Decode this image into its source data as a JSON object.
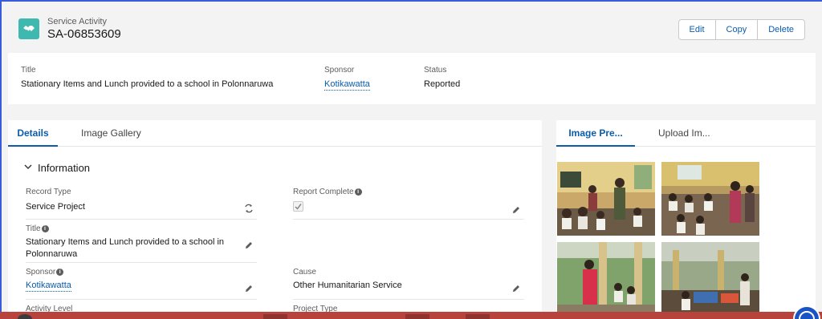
{
  "header": {
    "object_type": "Service Activity",
    "record_name": "SA-06853609",
    "buttons": {
      "edit": "Edit",
      "copy": "Copy",
      "delete": "Delete"
    }
  },
  "highlights": {
    "title_label": "Title",
    "title_value": "Stationary Items and Lunch provided to a school in Polonnaruwa",
    "sponsor_label": "Sponsor",
    "sponsor_value": "Kotikawatta",
    "status_label": "Status",
    "status_value": "Reported"
  },
  "left_tabs": {
    "details": "Details",
    "gallery": "Image Gallery"
  },
  "section": {
    "title": "Information"
  },
  "fields": {
    "record_type_label": "Record Type",
    "record_type_value": "Service Project",
    "report_complete_label": "Report Complete",
    "report_complete_checked": true,
    "title_label": "Title",
    "title_value": "Stationary Items and Lunch provided to a school in Polonnaruwa",
    "sponsor_label": "Sponsor",
    "sponsor_value": "Kotikawatta",
    "cause_label": "Cause",
    "cause_value": "Other Humanitarian Service",
    "activity_level_label": "Activity Level",
    "project_type_label": "Project Type"
  },
  "right_tabs": {
    "preview": "Image Pre...",
    "upload": "Upload Im..."
  },
  "colors": {
    "brand": "#0b5cab",
    "object_icon": "#3fb8af",
    "bottom_bar": "#b8433c"
  }
}
